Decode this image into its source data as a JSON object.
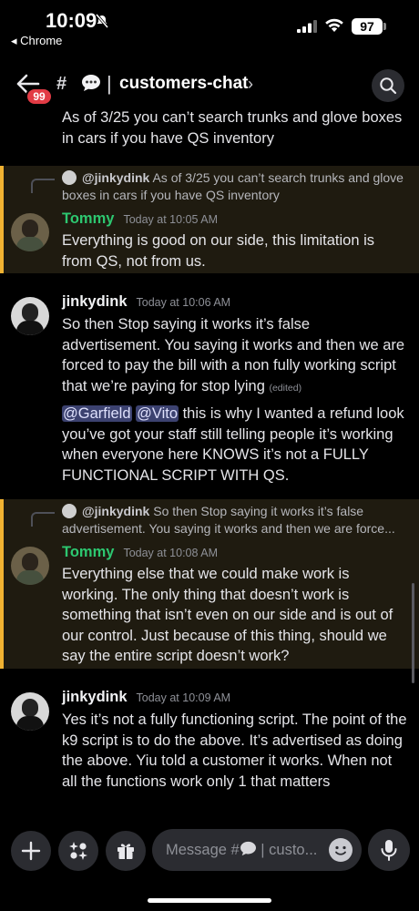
{
  "status": {
    "time": "10:09",
    "back_app": "◂ Chrome",
    "battery": "97"
  },
  "header": {
    "unread_badge": "99",
    "hash": "#",
    "separator": "|",
    "channel": "customers-chat",
    "chevron": "›"
  },
  "messages": [
    {
      "text": "As of 3/25 you can’t search trunks and glove boxes in cars if you have QS inventory"
    },
    {
      "reply": {
        "name": "@jinkydink",
        "text": "As of 3/25 you can’t search trunks and glove boxes in cars if you have QS inventory"
      },
      "author": "Tommy",
      "time": "Today at 10:05 AM",
      "text": "Everything is good on our side, this limitation is from QS, not from us."
    },
    {
      "author": "jinkydink",
      "time": "Today at 10:06 AM",
      "text": "So then Stop saying it works it’s false advertisement. You saying it works and then we are forced to pay the bill with a non fully working script that we’re paying for stop lying",
      "edited": "(edited)",
      "mention1": "@Garfield",
      "mention2": "@Vito",
      "text2": " this is why I wanted a refund look you’ve got your staff still telling people it’s working when everyone here KNOWS it’s not a FULLY FUNCTIONAL SCRIPT WITH QS."
    },
    {
      "reply": {
        "name": "@jinkydink",
        "text": "So then Stop saying it works it’s false advertisement. You saying it works and then we are force..."
      },
      "author": "Tommy",
      "time": "Today at 10:08 AM",
      "text": "Everything else that we could make work is working. The only thing that doesn’t work is something that isn’t even on our side and is out of our control. Just because of this thing, should we say the entire script doesn’t work?"
    },
    {
      "author": "jinkydink",
      "time": "Today at 10:09 AM",
      "text": "Yes it’s not a fully functioning script. The point of the k9 script is to do the above. It’s advertised as doing the above. Yiu told a customer it works. When not all the functions work only 1 that matters"
    }
  ],
  "composer": {
    "placeholder_a": "Message #",
    "placeholder_b": " | custo..."
  },
  "colors": {
    "highlight_bar": "#f0b232",
    "tommy_name": "#2dc770",
    "mention_bg": "#3c4270"
  }
}
